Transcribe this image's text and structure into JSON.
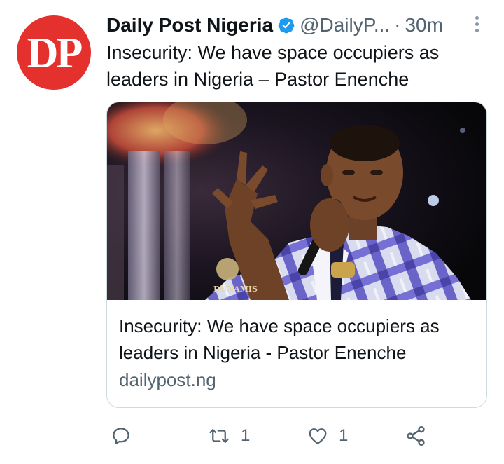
{
  "tweet": {
    "avatar_text": "DP",
    "display_name": "Daily Post Nigeria",
    "handle": "@DailyP...",
    "separator": "·",
    "time": "30m",
    "text": "Insecurity: We have space occupiers as leaders in Nigeria – Pastor Enenche"
  },
  "card": {
    "image_watermark": "DUNAMIS",
    "title": "Insecurity: We have space occupiers as leaders in Nigeria - Pastor Enenche",
    "domain": "dailypost.ng"
  },
  "actions": {
    "reply_icon": "reply-icon",
    "retweet_icon": "retweet-icon",
    "retweet_count": "1",
    "like_icon": "heart-icon",
    "like_count": "1",
    "share_icon": "share-icon"
  },
  "colors": {
    "brand_red": "#e5312d",
    "verified_blue": "#1d9bf0",
    "secondary_text": "#536471",
    "primary_text": "#0f1419",
    "border": "#cfd9de"
  }
}
